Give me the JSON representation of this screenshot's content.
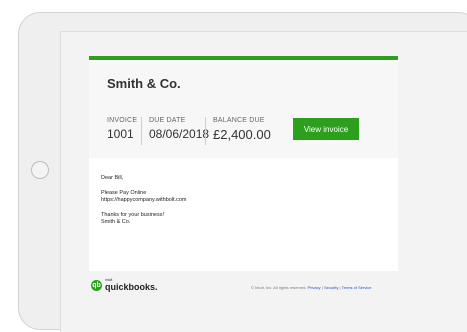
{
  "invoice": {
    "company": "Smith & Co.",
    "invoice_label": "INVOICE",
    "invoice_number": "1001",
    "due_label": "DUE DATE",
    "due_date": "08/06/2018",
    "balance_label": "BALANCE DUE",
    "balance": "£2,400.00",
    "view_button": "View invoice"
  },
  "message": {
    "greeting": "Dear Bill,",
    "line1": "Please Pay Online",
    "link": "https://happycompany.withbolt.com",
    "thanks": "Thanks for your business!",
    "signature": "Smith & Co."
  },
  "footer": {
    "brand_small": "intuit",
    "brand": "quickbooks.",
    "copyright": "© Intuit, Inc. All rights reserved.",
    "privacy": "Privacy",
    "security": "Security",
    "terms": "Terms of Service",
    "separator": "|"
  },
  "colors": {
    "accent": "#2ca01c",
    "link": "#1a4fd6"
  },
  "icons": {
    "logo": "quickbooks-logo-icon",
    "home": "home-button-icon"
  }
}
